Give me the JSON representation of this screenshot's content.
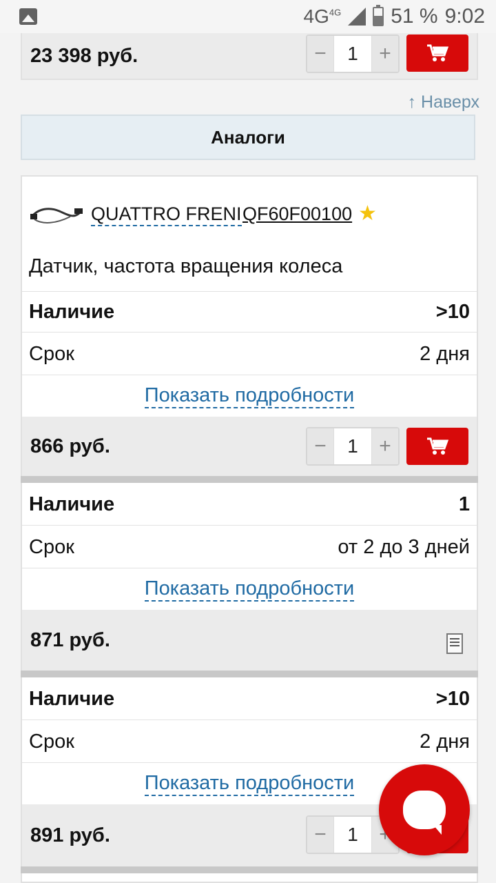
{
  "status_bar": {
    "network": "4G",
    "network_sup": "4G",
    "battery": "51 %",
    "time": "9:02"
  },
  "top_card": {
    "price": "23 398 руб.",
    "qty": "1"
  },
  "to_top": "↑ Наверх",
  "analogs": "Аналоги",
  "product": {
    "brand": "QUATTRO FRENI",
    "article": "QF60F00100",
    "name": "Датчик, частота вращения колеса"
  },
  "labels": {
    "availability": "Наличие",
    "term": "Срок",
    "details": "Показать подробности",
    "minus": "−",
    "plus": "+"
  },
  "offers": [
    {
      "availability": ">10",
      "term": "2 дня",
      "price": "866 руб.",
      "qty": "1"
    },
    {
      "availability": "1",
      "term": "от 2 до 3 дней",
      "price": "871 руб."
    },
    {
      "availability": ">10",
      "term": "2 дня",
      "price": "891 руб.",
      "qty": "1"
    }
  ],
  "colors": {
    "accent": "#d70a0a",
    "link": "#1f6aa3",
    "star": "#f4c20d"
  }
}
